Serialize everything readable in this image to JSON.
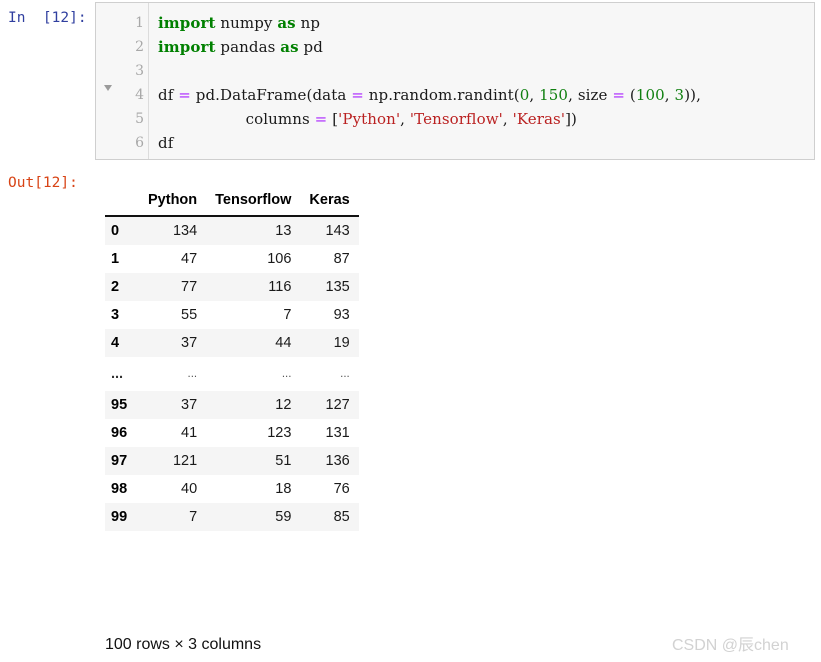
{
  "input_cell": {
    "prompt": "In  [12]:",
    "line_numbers": [
      "1",
      "2",
      "3",
      "4",
      "5",
      "6"
    ],
    "fold_arrow_icon": "triangle-down-icon",
    "code_lines": [
      [
        {
          "t": "import",
          "c": "k"
        },
        {
          "t": " numpy ",
          "c": "p"
        },
        {
          "t": "as",
          "c": "k"
        },
        {
          "t": " np",
          "c": "p"
        }
      ],
      [
        {
          "t": "import",
          "c": "k"
        },
        {
          "t": " pandas ",
          "c": "p"
        },
        {
          "t": "as",
          "c": "k"
        },
        {
          "t": " pd",
          "c": "p"
        }
      ],
      [],
      [
        {
          "t": "df ",
          "c": "p"
        },
        {
          "t": "=",
          "c": "op"
        },
        {
          "t": " pd.DataFrame(data ",
          "c": "p"
        },
        {
          "t": "=",
          "c": "op"
        },
        {
          "t": " np.random.randint(",
          "c": "p"
        },
        {
          "t": "0",
          "c": "n"
        },
        {
          "t": ", ",
          "c": "p"
        },
        {
          "t": "150",
          "c": "n"
        },
        {
          "t": ", size ",
          "c": "p"
        },
        {
          "t": "=",
          "c": "op"
        },
        {
          "t": " (",
          "c": "p"
        },
        {
          "t": "100",
          "c": "n"
        },
        {
          "t": ", ",
          "c": "p"
        },
        {
          "t": "3",
          "c": "n"
        },
        {
          "t": ")),",
          "c": "p"
        }
      ],
      [
        {
          "t": "                  columns ",
          "c": "p"
        },
        {
          "t": "=",
          "c": "op"
        },
        {
          "t": " [",
          "c": "p"
        },
        {
          "t": "'Python'",
          "c": "s"
        },
        {
          "t": ", ",
          "c": "p"
        },
        {
          "t": "'Tensorflow'",
          "c": "s"
        },
        {
          "t": ", ",
          "c": "p"
        },
        {
          "t": "'Keras'",
          "c": "s"
        },
        {
          "t": "])",
          "c": "p"
        }
      ],
      [
        {
          "t": "df",
          "c": "p"
        }
      ]
    ]
  },
  "output_cell": {
    "prompt": "Out[12]:",
    "shape_label": "100 rows × 3 columns",
    "table": {
      "index_header": "",
      "columns": [
        "Python",
        "Tensorflow",
        "Keras"
      ],
      "rows": [
        {
          "index": "0",
          "values": [
            "134",
            "13",
            "143"
          ]
        },
        {
          "index": "1",
          "values": [
            "47",
            "106",
            "87"
          ]
        },
        {
          "index": "2",
          "values": [
            "77",
            "116",
            "135"
          ]
        },
        {
          "index": "3",
          "values": [
            "55",
            "7",
            "93"
          ]
        },
        {
          "index": "4",
          "values": [
            "37",
            "44",
            "19"
          ]
        },
        {
          "index": "...",
          "values": [
            "...",
            "...",
            "..."
          ],
          "ellipsis": true
        },
        {
          "index": "95",
          "values": [
            "37",
            "12",
            "127"
          ]
        },
        {
          "index": "96",
          "values": [
            "41",
            "123",
            "131"
          ]
        },
        {
          "index": "97",
          "values": [
            "121",
            "51",
            "136"
          ]
        },
        {
          "index": "98",
          "values": [
            "40",
            "18",
            "76"
          ]
        },
        {
          "index": "99",
          "values": [
            "7",
            "59",
            "85"
          ]
        }
      ]
    }
  },
  "watermark": {
    "text": "CSDN @辰chen"
  },
  "colors": {
    "prompt_in": "#303f9f",
    "prompt_out": "#d84315",
    "keyword": "#008000",
    "operator": "#aa22ff",
    "number": "#108010",
    "string": "#ba2121",
    "cell_background": "#f7f7f7",
    "cell_border": "#cfcfcf",
    "row_stripe": "#f5f5f5",
    "watermark": "#d2d2d2"
  }
}
